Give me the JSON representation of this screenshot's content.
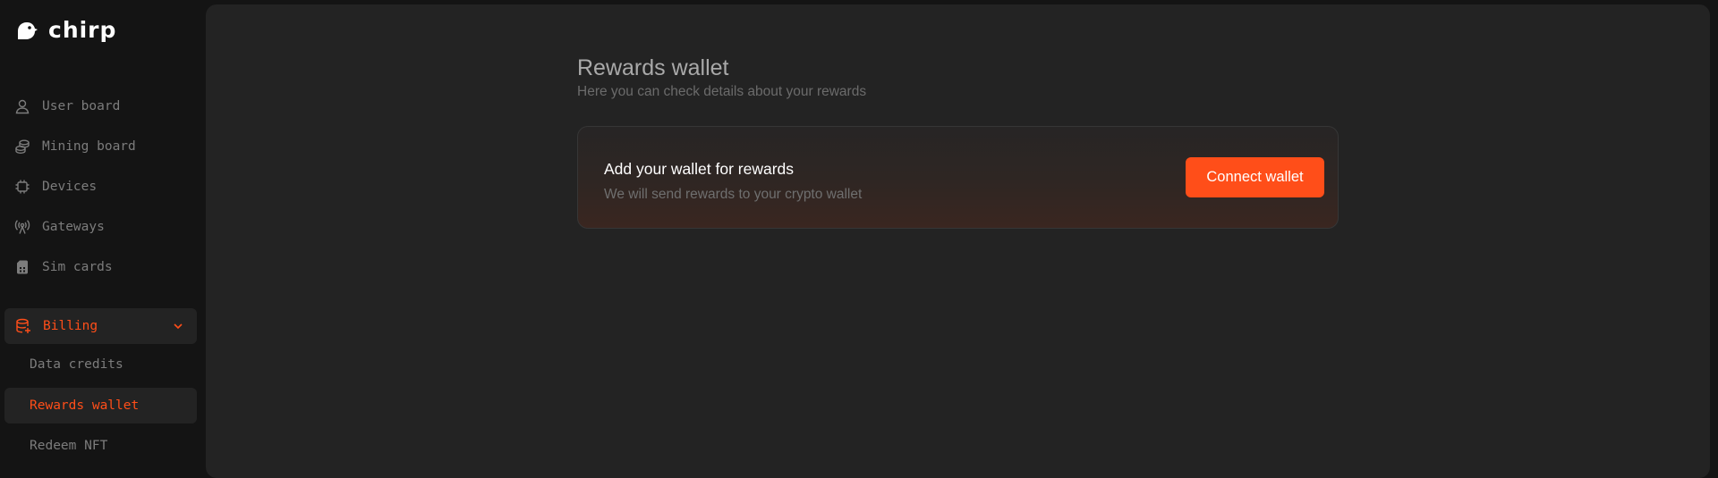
{
  "app": {
    "logo_text": "chirp",
    "accent_color": "#ff4e19"
  },
  "sidebar": {
    "items": [
      {
        "label": "User board",
        "icon": "user-icon"
      },
      {
        "label": "Mining board",
        "icon": "coins-icon"
      },
      {
        "label": "Devices",
        "icon": "chip-icon"
      },
      {
        "label": "Gateways",
        "icon": "antenna-icon"
      },
      {
        "label": "Sim cards",
        "icon": "sim-card-icon"
      }
    ],
    "billing": {
      "label": "Billing",
      "icon": "database-icon",
      "expanded": true,
      "children": [
        {
          "label": "Data credits",
          "active": false
        },
        {
          "label": "Rewards wallet",
          "active": true
        },
        {
          "label": "Redeem NFT",
          "active": false
        }
      ]
    }
  },
  "main": {
    "title": "Rewards wallet",
    "subtitle": "Here you can check details about your rewards",
    "card": {
      "title": "Add your wallet for rewards",
      "description": "We will send rewards to your crypto wallet",
      "button_label": "Connect wallet"
    }
  }
}
